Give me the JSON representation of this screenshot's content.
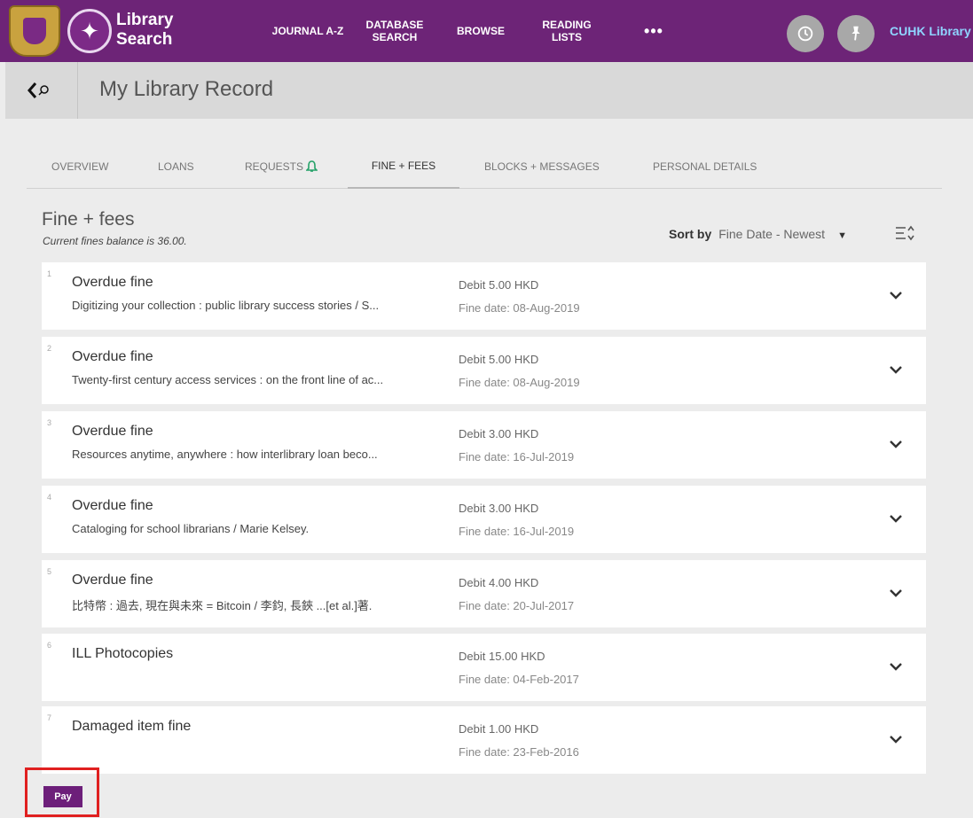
{
  "header": {
    "logo_line1": "Library",
    "logo_line2": "Search",
    "nav": [
      {
        "line1": "JOURNAL A-Z",
        "line2": ""
      },
      {
        "line1": "DATABASE",
        "line2": "SEARCH"
      },
      {
        "line1": "BROWSE",
        "line2": ""
      },
      {
        "line1": "READING",
        "line2": "LISTS"
      },
      {
        "line1": "•••",
        "line2": ""
      }
    ],
    "account_link": "CUHK Library"
  },
  "subheader": {
    "title": "My Library Record"
  },
  "tabs": [
    {
      "label": "OVERVIEW"
    },
    {
      "label": "LOANS"
    },
    {
      "label": "REQUESTS"
    },
    {
      "label": "FINE + FEES"
    },
    {
      "label": "BLOCKS + MESSAGES"
    },
    {
      "label": "PERSONAL DETAILS"
    }
  ],
  "section": {
    "title": "Fine + fees",
    "balance": "Current fines balance is 36.00.",
    "sort_label": "Sort by",
    "sort_value": "Fine Date - Newest"
  },
  "fines": [
    {
      "num": "1",
      "type": "Overdue fine",
      "title": "Digitizing your collection : public library success stories / S...",
      "debit": "Debit 5.00 HKD",
      "date": "Fine date: 08-Aug-2019"
    },
    {
      "num": "2",
      "type": "Overdue fine",
      "title": "Twenty-first century access services : on the front line of ac...",
      "debit": "Debit 5.00 HKD",
      "date": "Fine date: 08-Aug-2019"
    },
    {
      "num": "3",
      "type": "Overdue fine",
      "title": "Resources anytime, anywhere : how interlibrary loan beco...",
      "debit": "Debit 3.00 HKD",
      "date": "Fine date: 16-Jul-2019"
    },
    {
      "num": "4",
      "type": "Overdue fine",
      "title": "Cataloging for school librarians / Marie Kelsey.",
      "debit": "Debit 3.00 HKD",
      "date": "Fine date: 16-Jul-2019"
    },
    {
      "num": "5",
      "type": "Overdue fine",
      "title": "比特幣 : 過去, 現在與未來 = Bitcoin / 李鈞, 長鋏 ...[et al.]著.",
      "debit": "Debit 4.00 HKD",
      "date": "Fine date: 20-Jul-2017"
    },
    {
      "num": "6",
      "type": "ILL Photocopies",
      "title": "",
      "debit": "Debit 15.00 HKD",
      "date": "Fine date: 04-Feb-2017"
    },
    {
      "num": "7",
      "type": "Damaged item fine",
      "title": "",
      "debit": "Debit 1.00 HKD",
      "date": "Fine date: 23-Feb-2016"
    }
  ],
  "actions": {
    "pay_label": "Pay"
  },
  "colors": {
    "brand_purple": "#6d2477",
    "pay_button": "#6d1f7a",
    "highlight_border": "#e02020",
    "bell_green": "#26a269",
    "account_link": "#8fd4ff"
  }
}
